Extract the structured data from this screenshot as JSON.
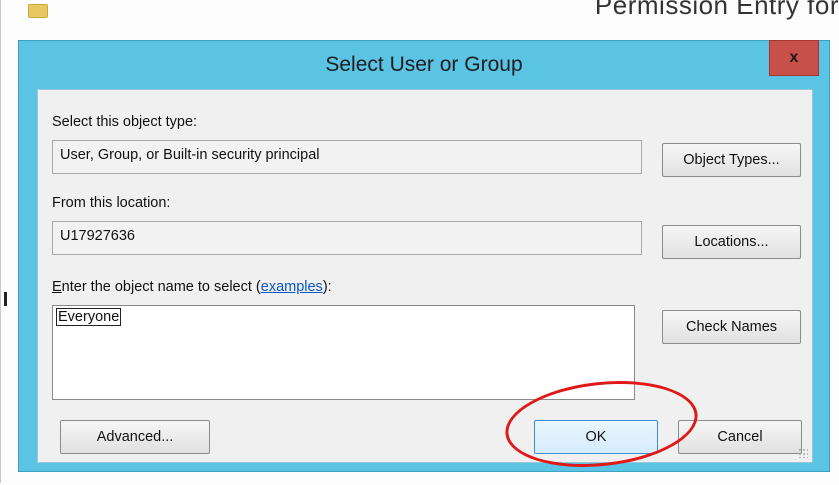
{
  "background_window": {
    "title": "Permission Entry for"
  },
  "dialog": {
    "title": "Select User or Group",
    "close_label": "x",
    "object_type": {
      "label": "Select this object type:",
      "value": "User, Group, or Built-in security principal",
      "button": "Object Types..."
    },
    "location": {
      "label": "From this location:",
      "value": "U17927636",
      "button": "Locations..."
    },
    "object_name": {
      "label_prefix_underlined": "E",
      "label_prefix_rest": "nter the object name to select (",
      "link": "examples",
      "label_suffix": "):",
      "value": "Everyone",
      "button": "Check Names"
    },
    "buttons": {
      "advanced": "Advanced...",
      "ok": "OK",
      "cancel": "Cancel"
    }
  },
  "colors": {
    "dialog_frame": "#5bc3e3",
    "close_button": "#c7514a",
    "annotation_circle": "#e01818",
    "link": "#0a57c8"
  }
}
